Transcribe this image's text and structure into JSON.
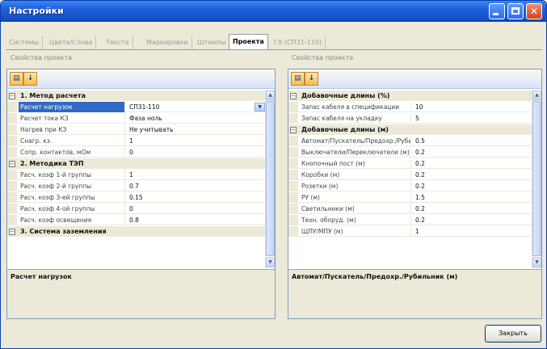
{
  "window": {
    "title": "Настройки"
  },
  "tabs": [
    {
      "label": "Системы",
      "active": false
    },
    {
      "label": "Цвета/Слова",
      "active": false
    },
    {
      "label": "Текста",
      "active": false
    },
    {
      "label": "Маркировки",
      "active": false
    },
    {
      "label": "Штампы",
      "active": false
    },
    {
      "label": "Проекта",
      "active": true
    },
    {
      "label": "ГХ (СП31-110)",
      "active": false
    }
  ],
  "left_panel": {
    "title": "Свойства проекта",
    "description": "Расчет нагрузок",
    "rows": [
      {
        "type": "cat",
        "key": "1. Метод расчета"
      },
      {
        "type": "prop",
        "key": "Расчет нагрузок",
        "value": "СП31-110",
        "selected": true,
        "dropdown": true
      },
      {
        "type": "prop",
        "key": "Расчет тока КЗ",
        "value": "Фаза ноль"
      },
      {
        "type": "prop",
        "key": "Нагрев при КЗ",
        "value": "Не учитывать"
      },
      {
        "type": "prop",
        "key": "Снагр. кз.",
        "value": "1"
      },
      {
        "type": "prop",
        "key": "Сопр. контактов, мОм",
        "value": "0"
      },
      {
        "type": "cat",
        "key": "2. Методика ТЭП"
      },
      {
        "type": "prop",
        "key": "Расч. коэф 1-й группы",
        "value": "1"
      },
      {
        "type": "prop",
        "key": "Расч. коэф 2-й группы",
        "value": "0.7"
      },
      {
        "type": "prop",
        "key": "Расч. коэф 3-ей группы",
        "value": "0.15"
      },
      {
        "type": "prop",
        "key": "Расч. коэф 4-ой группы",
        "value": "0"
      },
      {
        "type": "prop",
        "key": "Расч. коэф освещения",
        "value": "0.8"
      },
      {
        "type": "cat",
        "key": "3. Система заземления"
      }
    ]
  },
  "right_panel": {
    "title": "Свойства проекта",
    "description": "Автомат/Пускатель/Предохр./Рубильник (м)",
    "rows": [
      {
        "type": "cat",
        "key": "Добавочные длины (%)"
      },
      {
        "type": "prop",
        "key": "Запас кабеля в спецификации",
        "value": "10"
      },
      {
        "type": "prop",
        "key": "Запас кабеля на укладку",
        "value": "5"
      },
      {
        "type": "cat",
        "key": "Добавочные длины (м)"
      },
      {
        "type": "prop",
        "key": "Автомат/Пускатель/Предохр./Рубильник (м)",
        "value": "0.5"
      },
      {
        "type": "prop",
        "key": "Выключатели/Переключатели (м)",
        "value": "0.2"
      },
      {
        "type": "prop",
        "key": "Кнопочный пост (м)",
        "value": "0.2"
      },
      {
        "type": "prop",
        "key": "Коробки (м)",
        "value": "0.2"
      },
      {
        "type": "prop",
        "key": "Розетки (м)",
        "value": "0.2"
      },
      {
        "type": "prop",
        "key": "РУ (м)",
        "value": "1.5"
      },
      {
        "type": "prop",
        "key": "Светильники (м)",
        "value": "0.2"
      },
      {
        "type": "prop",
        "key": "Техн. оборуд. (м)",
        "value": "0.2"
      },
      {
        "type": "prop",
        "key": "ЩПУ/МПУ (м)",
        "value": "1"
      }
    ]
  },
  "footer": {
    "close_label": "Закрыть"
  }
}
